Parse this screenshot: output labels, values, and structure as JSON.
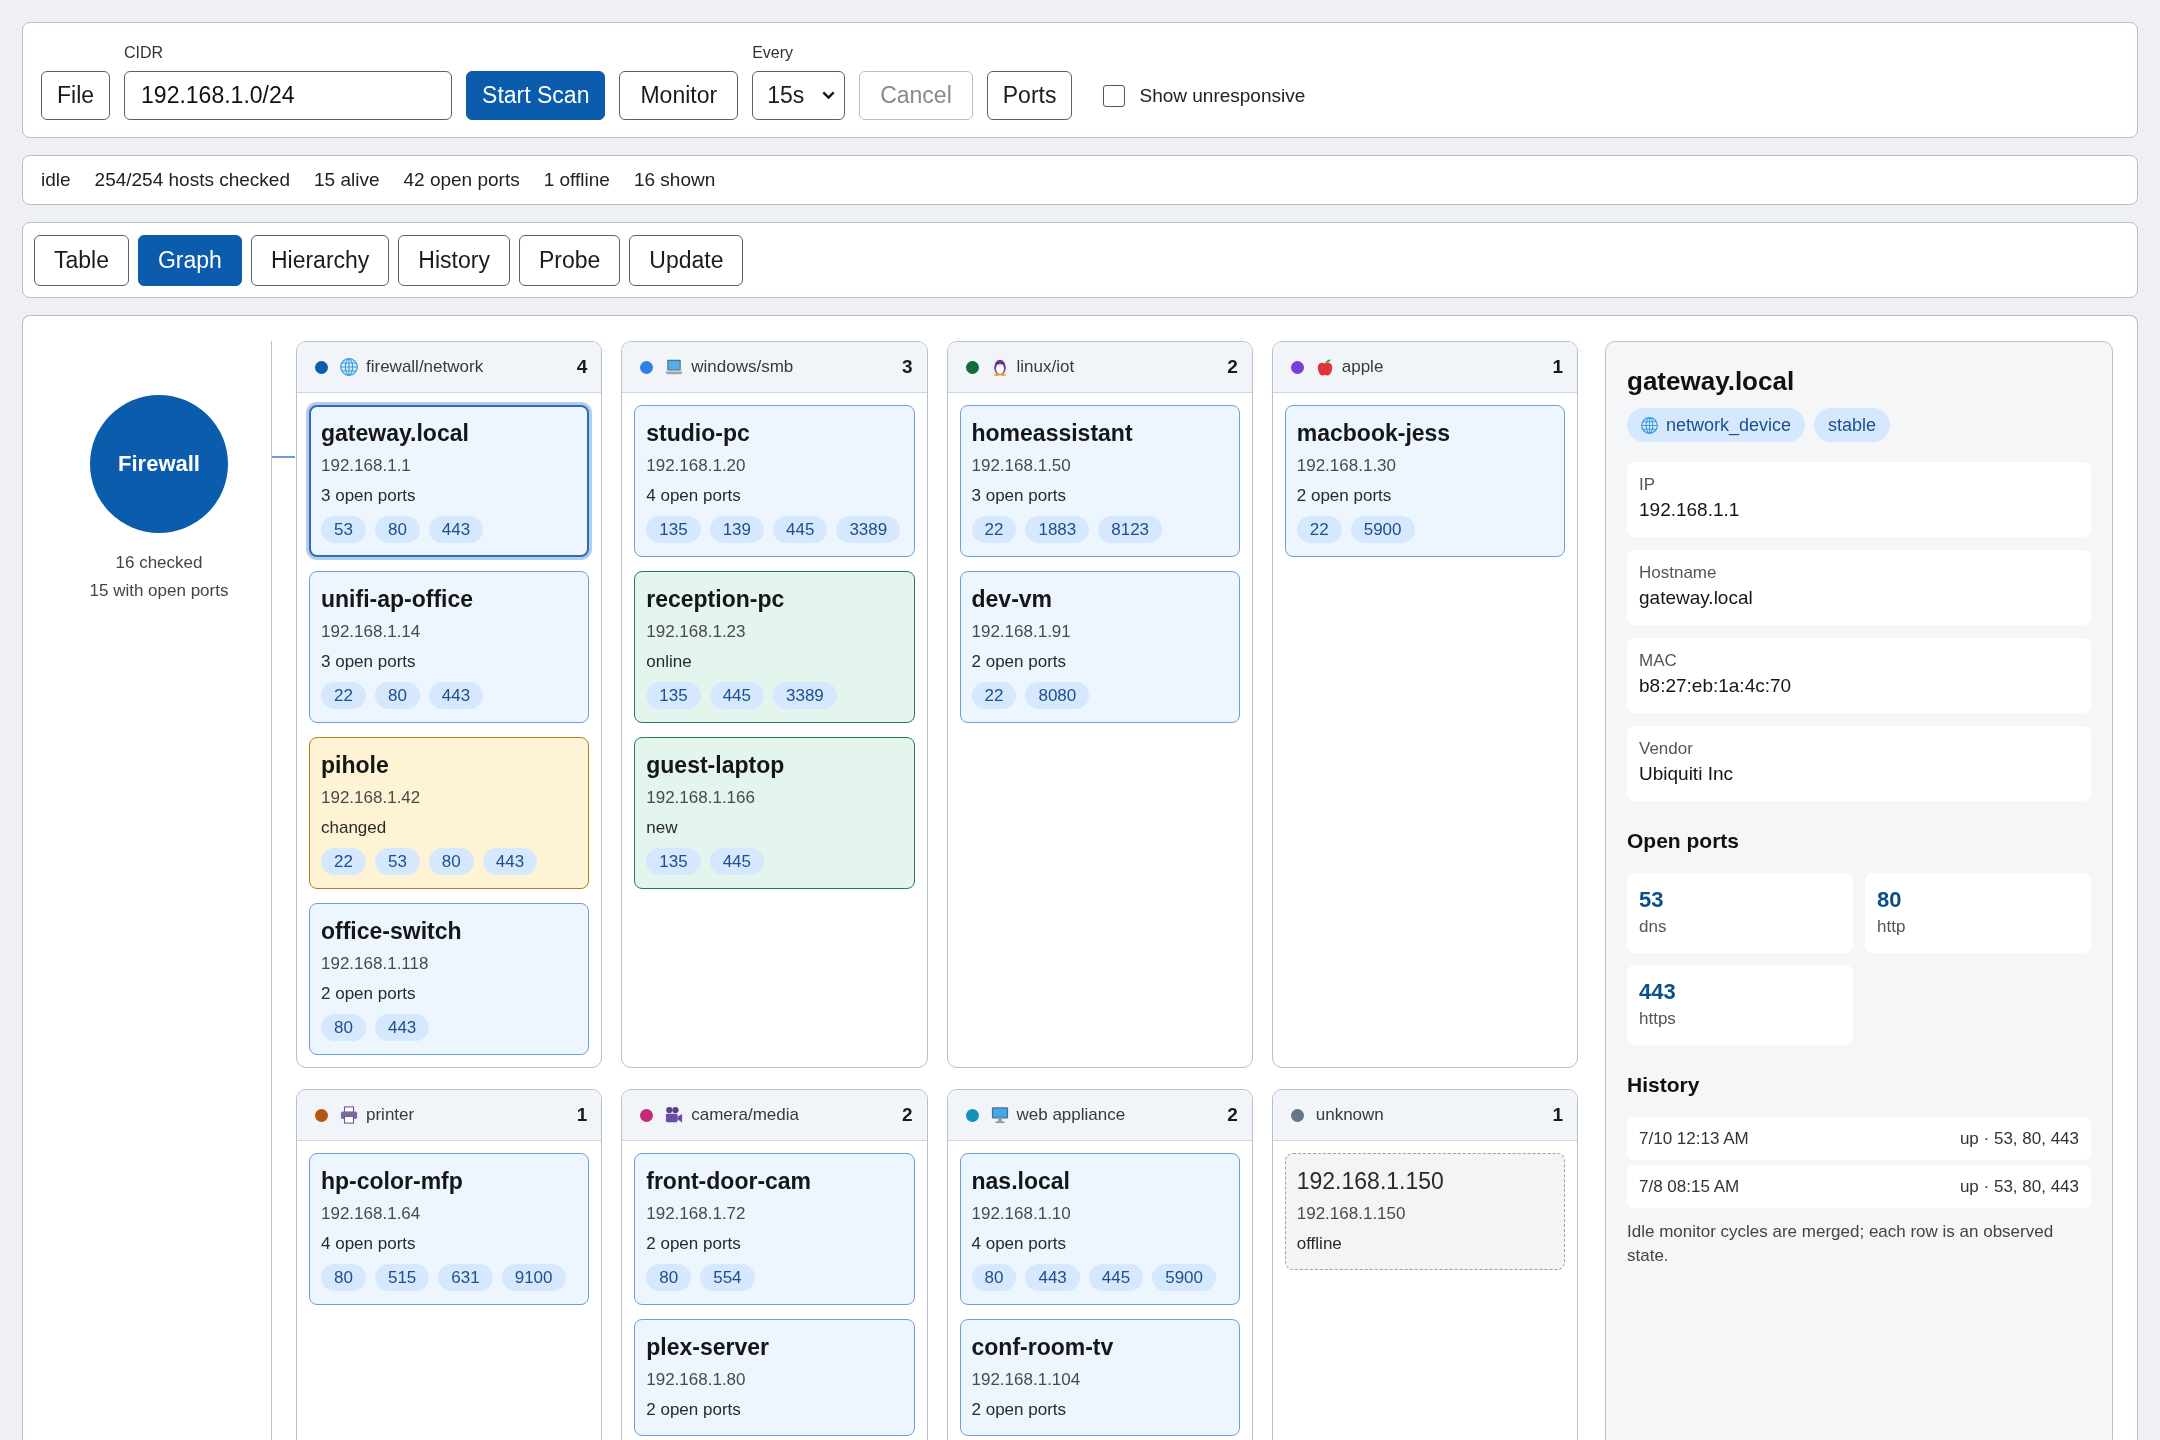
{
  "toolbar": {
    "file_button": "File",
    "cidr": {
      "label": "CIDR",
      "value": "192.168.1.0/24"
    },
    "start_button": "Start Scan",
    "monitor_button": "Monitor",
    "interval": {
      "label": "Every",
      "value": "15s"
    },
    "cancel": {
      "label": "Cancel",
      "disabled": true
    },
    "ports_button": "Ports",
    "show_unresponsive": {
      "label": "Show unresponsive",
      "checked": false
    }
  },
  "status_bar": [
    "idle",
    "254/254 hosts checked",
    "15 alive",
    "42 open ports",
    "1 offline",
    "16 shown"
  ],
  "tabs": [
    {
      "label": "Table",
      "selected": false
    },
    {
      "label": "Graph",
      "selected": true
    },
    {
      "label": "Hierarchy",
      "selected": false
    },
    {
      "label": "History",
      "selected": false
    },
    {
      "label": "Probe",
      "selected": false
    },
    {
      "label": "Update",
      "selected": false
    }
  ],
  "graph": {
    "root": {
      "label": "Firewall",
      "lines": [
        "16 checked",
        "15 with open ports"
      ]
    },
    "groups": [
      {
        "label": "firewall/network",
        "count": "4",
        "color": "#0b5cad",
        "kind": "network",
        "hosts": [
          {
            "name": "gateway.local",
            "ip": "192.168.1.1",
            "summary": "3 open ports",
            "ports": [
              "53",
              "80",
              "443"
            ],
            "kind": "stable",
            "selected": true
          },
          {
            "name": "unifi-ap-office",
            "ip": "192.168.1.14",
            "summary": "3 open ports",
            "ports": [
              "22",
              "80",
              "443"
            ],
            "kind": "stable",
            "selected": false
          },
          {
            "name": "pihole",
            "ip": "192.168.1.42",
            "summary": "changed",
            "ports": [
              "22",
              "53",
              "80",
              "443"
            ],
            "kind": "changed",
            "selected": false
          },
          {
            "name": "office-switch",
            "ip": "192.168.1.118",
            "summary": "2 open ports",
            "ports": [
              "80",
              "443"
            ],
            "kind": "stable",
            "selected": false
          }
        ]
      },
      {
        "label": "windows/smb",
        "count": "3",
        "color": "#2f80e4",
        "kind": "windows",
        "hosts": [
          {
            "name": "studio-pc",
            "ip": "192.168.1.20",
            "summary": "4 open ports",
            "ports": [
              "135",
              "139",
              "445",
              "3389"
            ],
            "kind": "stable",
            "selected": false
          },
          {
            "name": "reception-pc",
            "ip": "192.168.1.23",
            "summary": "online",
            "ports": [
              "135",
              "445",
              "3389"
            ],
            "kind": "online",
            "selected": false
          },
          {
            "name": "guest-laptop",
            "ip": "192.168.1.166",
            "summary": "new",
            "ports": [
              "135",
              "445"
            ],
            "kind": "new",
            "selected": false
          }
        ]
      },
      {
        "label": "linux/iot",
        "count": "2",
        "color": "#116b3e",
        "kind": "linux",
        "hosts": [
          {
            "name": "homeassistant",
            "ip": "192.168.1.50",
            "summary": "3 open ports",
            "ports": [
              "22",
              "1883",
              "8123"
            ],
            "kind": "stable",
            "selected": false
          },
          {
            "name": "dev-vm",
            "ip": "192.168.1.91",
            "summary": "2 open ports",
            "ports": [
              "22",
              "8080"
            ],
            "kind": "stable",
            "selected": false
          }
        ]
      },
      {
        "label": "apple",
        "count": "1",
        "color": "#7a3fd8",
        "kind": "apple",
        "hosts": [
          {
            "name": "macbook-jess",
            "ip": "192.168.1.30",
            "summary": "2 open ports",
            "ports": [
              "22",
              "5900"
            ],
            "kind": "stable",
            "selected": false
          }
        ]
      },
      {
        "label": "printer",
        "count": "1",
        "color": "#b5560f",
        "kind": "printer",
        "hosts": [
          {
            "name": "hp-color-mfp",
            "ip": "192.168.1.64",
            "summary": "4 open ports",
            "ports": [
              "80",
              "515",
              "631",
              "9100"
            ],
            "kind": "stable",
            "selected": false
          }
        ]
      },
      {
        "label": "camera/media",
        "count": "2",
        "color": "#c62a77",
        "kind": "camera",
        "hosts": [
          {
            "name": "front-door-cam",
            "ip": "192.168.1.72",
            "summary": "2 open ports",
            "ports": [
              "80",
              "554"
            ],
            "kind": "stable",
            "selected": false
          },
          {
            "name": "plex-server",
            "ip": "192.168.1.80",
            "summary": "2 open ports",
            "kind": "stable",
            "selected": false
          }
        ]
      },
      {
        "label": "web appliance",
        "count": "2",
        "color": "#1592b9",
        "kind": "web",
        "hosts": [
          {
            "name": "nas.local",
            "ip": "192.168.1.10",
            "summary": "4 open ports",
            "ports": [
              "80",
              "443",
              "445",
              "5900"
            ],
            "kind": "stable",
            "selected": false
          },
          {
            "name": "conf-room-tv",
            "ip": "192.168.1.104",
            "summary": "2 open ports",
            "kind": "stable",
            "selected": false
          }
        ]
      },
      {
        "label": "unknown",
        "count": "1",
        "color": "#66758a",
        "kind": "unknown",
        "hosts": [
          {
            "name": "192.168.1.150",
            "ip": "192.168.1.150",
            "summary": "offline",
            "kind": "offline",
            "selected": false
          }
        ]
      }
    ]
  },
  "details": {
    "title": "gateway.local",
    "tags": [
      {
        "label": "network_device",
        "kind": "network"
      },
      {
        "label": "stable",
        "kind": "plain"
      }
    ],
    "fields": [
      {
        "label": "IP",
        "value": "192.168.1.1"
      },
      {
        "label": "Hostname",
        "value": "gateway.local"
      },
      {
        "label": "MAC",
        "value": "b8:27:eb:1a:4c:70"
      },
      {
        "label": "Vendor",
        "value": "Ubiquiti Inc"
      }
    ],
    "open_ports_heading": "Open ports",
    "ports": [
      {
        "port": "53",
        "service": "dns"
      },
      {
        "port": "80",
        "service": "http"
      },
      {
        "port": "443",
        "service": "https"
      }
    ],
    "history_heading": "History",
    "history": [
      {
        "time": "7/10 12:13 AM",
        "state": "up · 53, 80, 443"
      },
      {
        "time": "7/8 08:15 AM",
        "state": "up · 53, 80, 443"
      }
    ],
    "note": "Idle monitor cycles are merged; each row is an observed state."
  }
}
